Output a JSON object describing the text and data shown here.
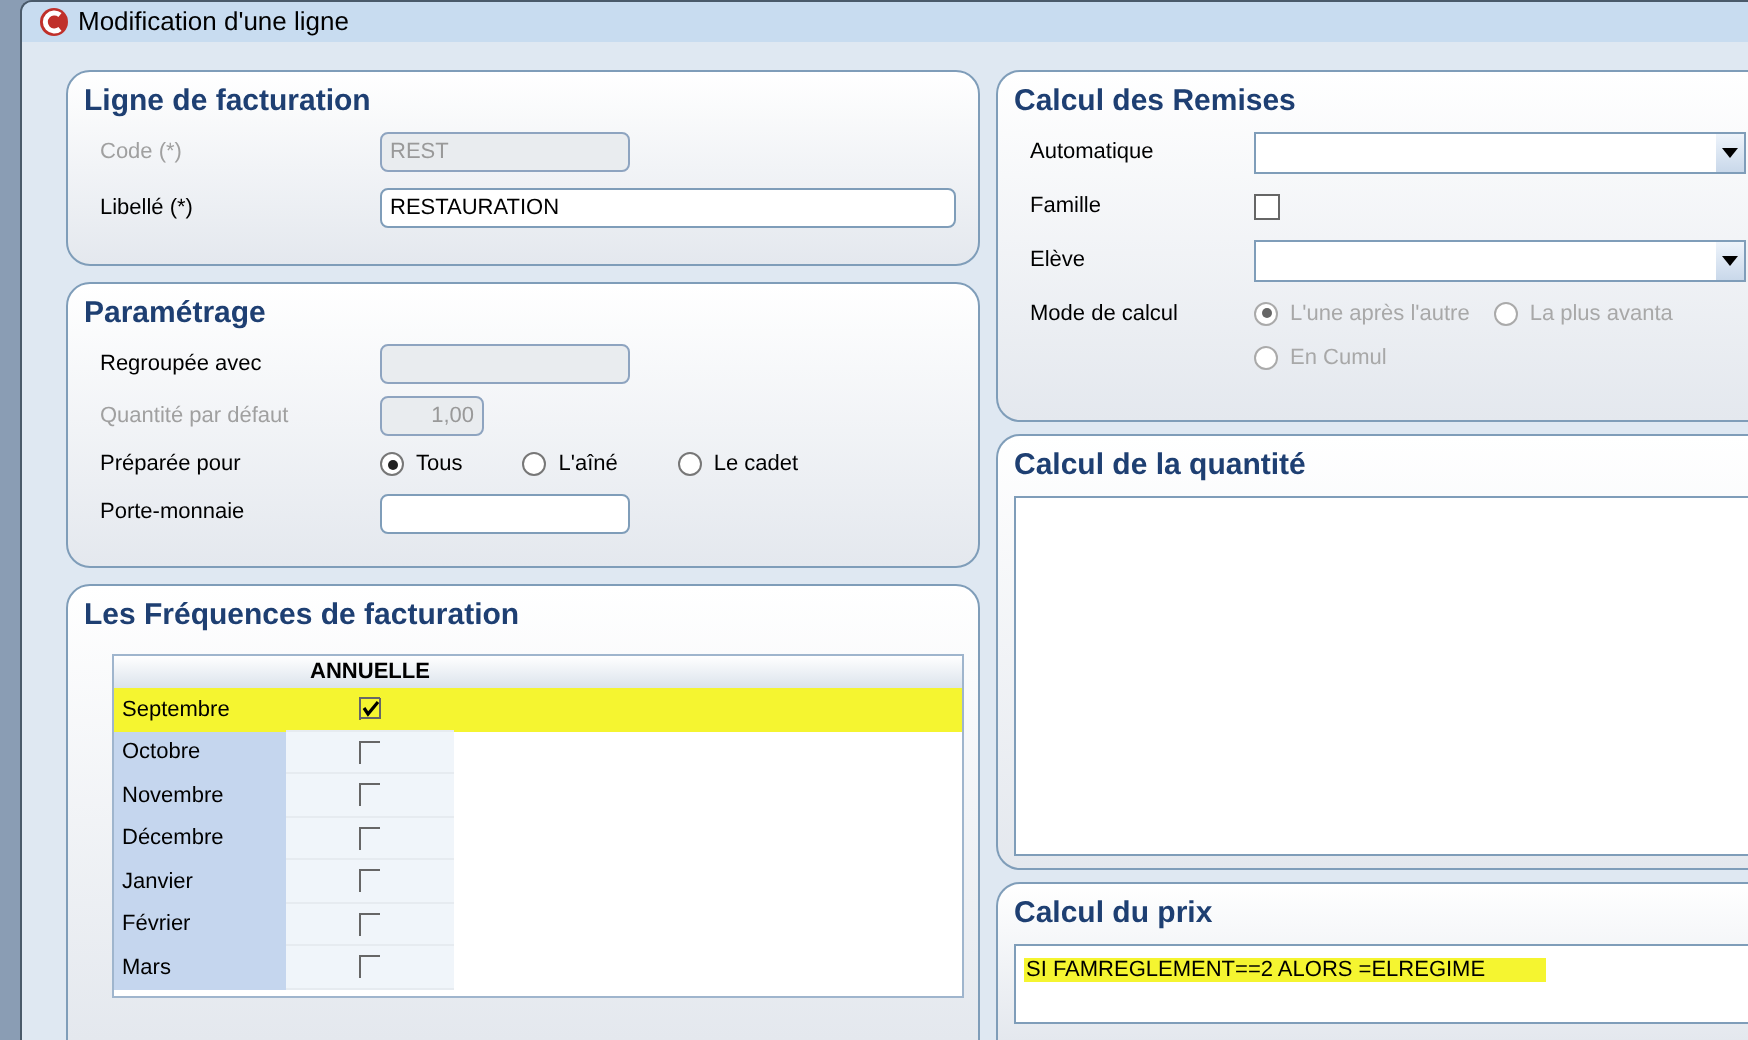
{
  "window": {
    "title": "Modification d'une ligne"
  },
  "ligne_de_facturation": {
    "title": "Ligne de facturation",
    "fields": [
      {
        "label": "Code (*)",
        "value": "REST",
        "disabled": true
      },
      {
        "label": "Libellé (*)",
        "value": "RESTAURATION",
        "disabled": false
      }
    ]
  },
  "parametrage": {
    "title": "Paramétrage",
    "regroupee": {
      "label": "Regroupée avec",
      "disabled": true
    },
    "quantite": {
      "label": "Quantité par défaut",
      "value": "1,00",
      "disabled": true
    },
    "preparee": {
      "label": "Préparée pour",
      "options": [
        {
          "label": "Tous",
          "selected": true
        },
        {
          "label": "L'aîné",
          "selected": false
        },
        {
          "label": "Le cadet",
          "selected": false
        }
      ]
    },
    "porte_monnaie": {
      "label": "Porte-monnaie",
      "disabled": false
    }
  },
  "frequences": {
    "title": "Les Fréquences de facturation",
    "column": "ANNUELLE",
    "rows": [
      {
        "month": "Septembre",
        "checked": true,
        "highlighted": true
      },
      {
        "month": "Octobre",
        "checked": false,
        "highlighted": false
      },
      {
        "month": "Novembre",
        "checked": false,
        "highlighted": false
      },
      {
        "month": "Décembre",
        "checked": false,
        "highlighted": false
      },
      {
        "month": "Janvier",
        "checked": false,
        "highlighted": false
      },
      {
        "month": "Février",
        "checked": false,
        "highlighted": false
      },
      {
        "month": "Mars",
        "checked": false,
        "highlighted": false
      }
    ]
  },
  "calcul_des_remises": {
    "title": "Calcul des Remises",
    "automatique": {
      "label": "Automatique"
    },
    "famille": {
      "label": "Famille",
      "checked": false
    },
    "eleve": {
      "label": "Elève"
    },
    "mode_de_calcul": {
      "label": "Mode de calcul",
      "disabled": true,
      "options": [
        {
          "label": "L'une après l'autre",
          "selected": true
        },
        {
          "label": "La plus avanta",
          "selected": false
        },
        {
          "label": "En Cumul",
          "selected": false
        }
      ]
    }
  },
  "calcul_de_la_quantite": {
    "title": "Calcul de la quantité"
  },
  "calcul_du_prix": {
    "title": "Calcul du prix",
    "value": "SI FAMREGLEMENT==2 ALORS =ELREGIME",
    "highlighted": true
  }
}
